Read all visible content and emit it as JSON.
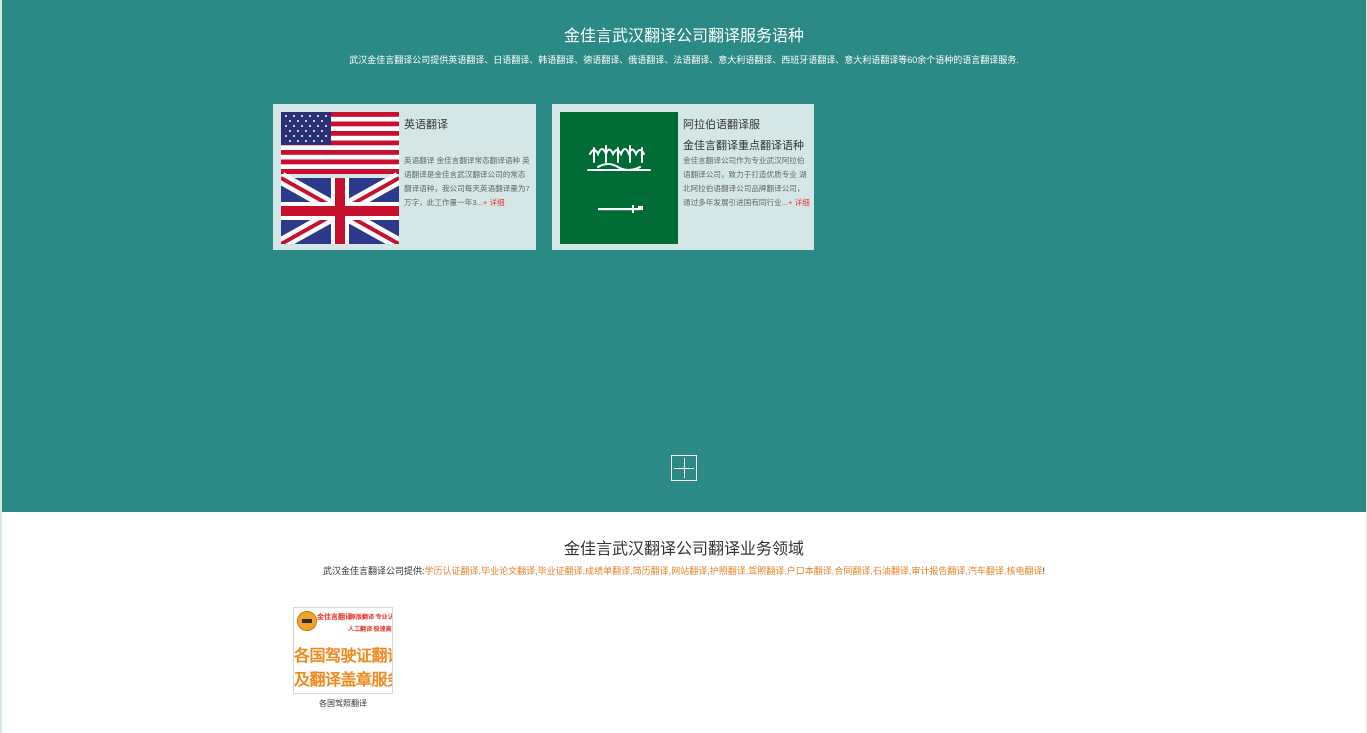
{
  "lang_section": {
    "title": "金佳言武汉翻译公司翻译服务语种",
    "subtitle": "武汉金佳言翻译公司提供英语翻译、日语翻译、韩语翻译、德语翻译、俄语翻译、法语翻译、意大利语翻译、西班牙语翻译、意大利语翻译等60余个语种的语言翻译服务.",
    "cards": [
      {
        "title": "英语翻译",
        "subtitle": "",
        "description": "英语翻译 金佳言翻译常态翻译语种 英语翻译是金佳言武汉翻译公司的常态翻译语种，我公司每天英语翻译量为7万字，此工作量一年3...",
        "more": "+ 详细",
        "flag_icons": [
          "usa-flag-icon",
          "uk-flag-icon"
        ]
      },
      {
        "title": "阿拉伯语翻译服",
        "subtitle": "金佳言翻译重点翻译语种",
        "description": "金佳言翻译公司作为专业武汉阿拉伯语翻译公司，致力于打造优质专业 湖北阿拉伯语翻译公司品牌翻译公司，通过多年发展引进国有同行业...",
        "more": "+ 详细",
        "flag_icons": [
          "saudi-flag-icon"
        ]
      }
    ],
    "expand_icon": "plus-icon"
  },
  "biz_section": {
    "title": "金佳言武汉翻译公司翻译业务领域",
    "intro": "武汉金佳言翻译公司提供:",
    "links": [
      "学历认证翻译",
      "毕业论文翻译",
      "毕业证翻译",
      "成绩单翻译",
      "简历翻译",
      "网站翻译",
      "护照翻译",
      "驾照翻译",
      "户口本翻译",
      "合同翻译",
      "石油翻译",
      "审计报告翻译",
      "汽车翻译",
      "核电翻译"
    ],
    "ending": "!",
    "items": [
      {
        "caption": "各国驾照翻译",
        "thumb": {
          "brand": "金佳言翻译",
          "tag1": "原版翻译 专业认证",
          "tag2": "人工翻译 极速高效",
          "line1": "各国驾驶证翻译",
          "line2": "及翻译盖章服务"
        }
      }
    ]
  },
  "colors": {
    "teal": "#2b8a85",
    "card_bg": "#d4e6e6",
    "link_orange": "#e6822a",
    "more_red": "#e4393c"
  }
}
